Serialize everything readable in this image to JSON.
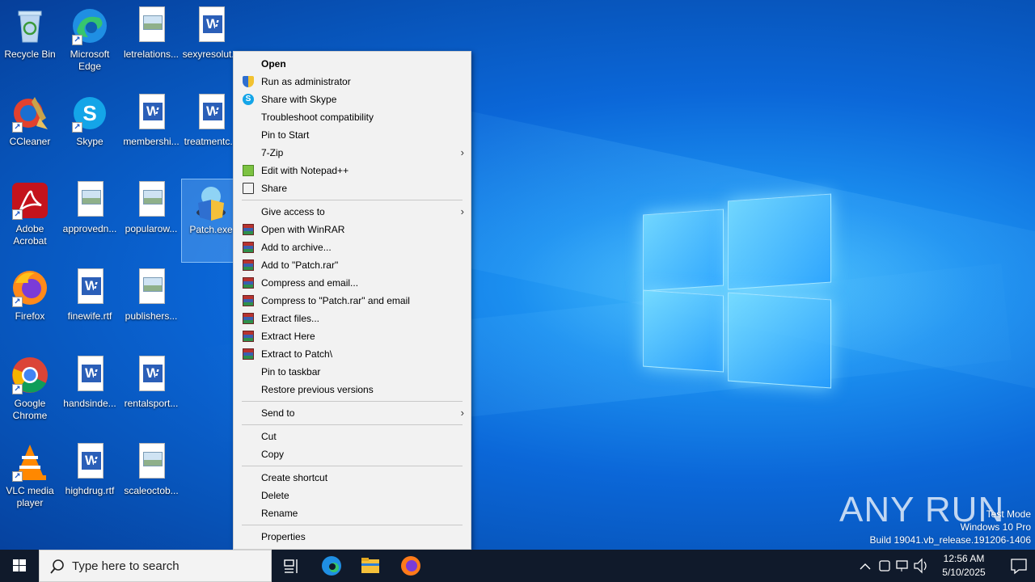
{
  "desktop_icons": [
    {
      "name": "recycle-bin",
      "label": "Recycle Bin",
      "kind": "recycle"
    },
    {
      "name": "microsoft-edge",
      "label": "Microsoft Edge",
      "kind": "edge"
    },
    {
      "name": "letrelations",
      "label": "letrelations...",
      "kind": "image"
    },
    {
      "name": "sexyresolut",
      "label": "sexyresolut...",
      "kind": "word"
    },
    {
      "name": "ccleaner",
      "label": "CCleaner",
      "kind": "ccleaner"
    },
    {
      "name": "skype",
      "label": "Skype",
      "kind": "skype"
    },
    {
      "name": "membershi",
      "label": "membershi...",
      "kind": "word"
    },
    {
      "name": "treatmentc",
      "label": "treatmentc...",
      "kind": "word"
    },
    {
      "name": "adobe-acrobat",
      "label": "Adobe Acrobat",
      "kind": "acrobat"
    },
    {
      "name": "approvedn",
      "label": "approvedn...",
      "kind": "image"
    },
    {
      "name": "popularow",
      "label": "popularow...",
      "kind": "image"
    },
    {
      "name": "patch-exe",
      "label": "Patch.exe",
      "kind": "patch"
    },
    {
      "name": "firefox",
      "label": "Firefox",
      "kind": "firefox"
    },
    {
      "name": "finewife",
      "label": "finewife.rtf",
      "kind": "word"
    },
    {
      "name": "publishers",
      "label": "publishers...",
      "kind": "image"
    },
    {
      "name": "google-chrome",
      "label": "Google Chrome",
      "kind": "chrome"
    },
    {
      "name": "handsinde",
      "label": "handsinde...",
      "kind": "word"
    },
    {
      "name": "rentalsport",
      "label": "rentalsport...",
      "kind": "word"
    },
    {
      "name": "vlc",
      "label": "VLC media player",
      "kind": "vlc"
    },
    {
      "name": "highdrug",
      "label": "highdrug.rtf",
      "kind": "word"
    },
    {
      "name": "scaleoctob",
      "label": "scaleoctob...",
      "kind": "image"
    }
  ],
  "context_menu": {
    "items": [
      {
        "label": "Open",
        "bold": true,
        "icon": ""
      },
      {
        "label": "Run as administrator",
        "icon": "shield"
      },
      {
        "label": "Share with Skype",
        "icon": "skype"
      },
      {
        "label": "Troubleshoot compatibility",
        "icon": ""
      },
      {
        "label": "Pin to Start",
        "icon": ""
      },
      {
        "label": "7-Zip",
        "icon": "",
        "submenu": true
      },
      {
        "label": "Edit with Notepad++",
        "icon": "npp"
      },
      {
        "label": "Share",
        "icon": "share"
      },
      {
        "separator": true
      },
      {
        "label": "Give access to",
        "icon": "",
        "submenu": true
      },
      {
        "label": "Open with WinRAR",
        "icon": "rar"
      },
      {
        "label": "Add to archive...",
        "icon": "rar"
      },
      {
        "label": "Add to \"Patch.rar\"",
        "icon": "rar"
      },
      {
        "label": "Compress and email...",
        "icon": "rar"
      },
      {
        "label": "Compress to \"Patch.rar\" and email",
        "icon": "rar"
      },
      {
        "label": "Extract files...",
        "icon": "rar"
      },
      {
        "label": "Extract Here",
        "icon": "rar"
      },
      {
        "label": "Extract to Patch\\",
        "icon": "rar"
      },
      {
        "label": "Pin to taskbar",
        "icon": ""
      },
      {
        "label": "Restore previous versions",
        "icon": ""
      },
      {
        "separator": true
      },
      {
        "label": "Send to",
        "icon": "",
        "submenu": true
      },
      {
        "separator": true
      },
      {
        "label": "Cut",
        "icon": ""
      },
      {
        "label": "Copy",
        "icon": ""
      },
      {
        "separator": true
      },
      {
        "label": "Create shortcut",
        "icon": ""
      },
      {
        "label": "Delete",
        "icon": ""
      },
      {
        "label": "Rename",
        "icon": ""
      },
      {
        "separator": true
      },
      {
        "label": "Properties",
        "icon": ""
      }
    ]
  },
  "watermark": {
    "brand": "ANY RUN",
    "line1": "Test Mode",
    "line2": "Windows 10 Pro",
    "line3": "Build 19041.vb_release.191206-1406"
  },
  "taskbar": {
    "search_placeholder": "Type here to search",
    "time": "12:56 AM",
    "date": "5/10/2025"
  }
}
